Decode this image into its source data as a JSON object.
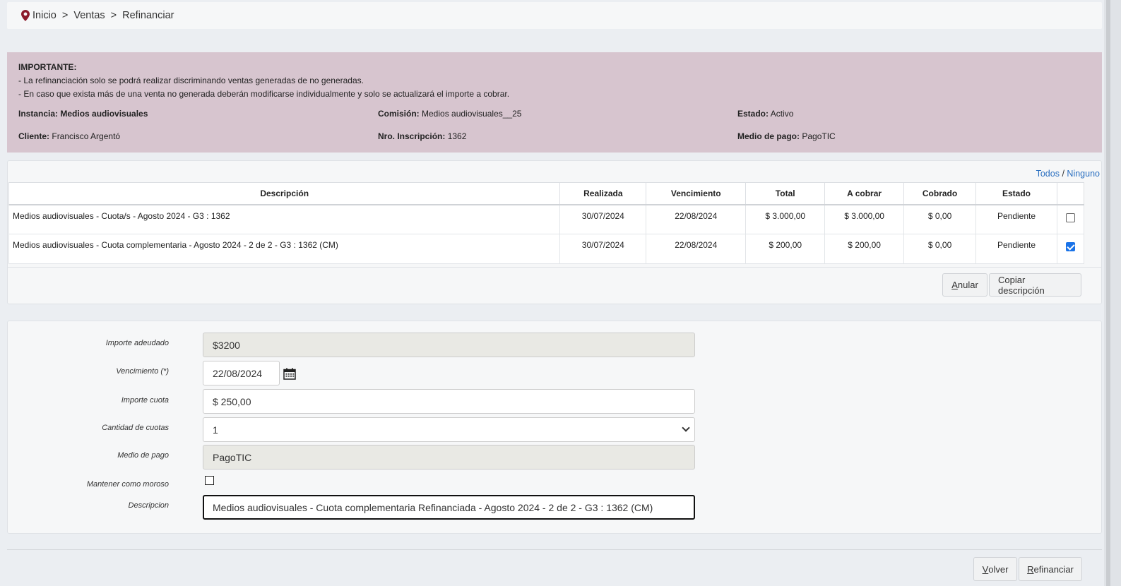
{
  "breadcrumb": {
    "items": [
      "Inicio",
      "Ventas",
      "Refinanciar"
    ],
    "separator": ">"
  },
  "alert": {
    "heading": "IMPORTANTE:",
    "lines": [
      "- La refinanciación solo se podrá realizar discriminando ventas generadas de no generadas.",
      "- En caso que exista más de una venta no generada deberán modificarse individualmente y solo se actualizará el importe a cobrar."
    ],
    "fields": {
      "instancia_label": "Instancia:",
      "instancia_value": "Medios audiovisuales",
      "comision_label": "Comisión:",
      "comision_value": "Medios audiovisuales__25",
      "estado_label": "Estado:",
      "estado_value": "Activo",
      "cliente_label": "Cliente:",
      "cliente_value": "Francisco Argentó",
      "inscripcion_label": "Nro. Inscripción:",
      "inscripcion_value": "1362",
      "medio_label": "Medio de pago:",
      "medio_value": "PagoTIC"
    }
  },
  "selection": {
    "all": "Todos",
    "slash": "/",
    "none": "Ninguno"
  },
  "table": {
    "columns": [
      "Descripción",
      "Realizada",
      "Vencimiento",
      "Total",
      "A cobrar",
      "Cobrado",
      "Estado"
    ],
    "rows": [
      {
        "descripcion": "Medios audiovisuales - Cuota/s - Agosto 2024 - G3 : 1362",
        "realizada": "30/07/2024",
        "vencimiento": "22/08/2024",
        "total": "$ 3.000,00",
        "a_cobrar": "$ 3.000,00",
        "cobrado": "$ 0,00",
        "estado": "Pendiente",
        "checked": false
      },
      {
        "descripcion": "Medios audiovisuales - Cuota complementaria - Agosto 2024 - 2 de 2 - G3 : 1362 (CM)",
        "realizada": "30/07/2024",
        "vencimiento": "22/08/2024",
        "total": "$ 200,00",
        "a_cobrar": "$ 200,00",
        "cobrado": "$ 0,00",
        "estado": "Pendiente",
        "checked": true
      }
    ]
  },
  "table_actions": {
    "anular_first": "A",
    "anular_rest": "nular",
    "copiar": "Copiar descripción"
  },
  "form": {
    "importe_adeudado_label": "Importe adeudado",
    "importe_adeudado_value": "$3200",
    "vencimiento_label": "Vencimiento (*)",
    "vencimiento_value": "22/08/2024",
    "importe_cuota_label": "Importe cuota",
    "importe_cuota_value": "$ 250,00",
    "cantidad_cuotas_label": "Cantidad de cuotas",
    "cantidad_cuotas_value": "1",
    "medio_pago_label": "Medio de pago",
    "medio_pago_value": "PagoTIC",
    "moroso_label": "Mantener como moroso",
    "moroso_checked": false,
    "descripcion_label": "Descripcion",
    "descripcion_value": "Medios audiovisuales - Cuota complementaria Refinanciada -  Agosto 2024 - 2 de 2 - G3 : 1362 (CM)"
  },
  "footer": {
    "volver_first": "V",
    "volver_rest": "olver",
    "refinanciar_first": "R",
    "refinanciar_rest": "efinanciar"
  },
  "colors": {
    "alert_bg": "#d7c5cf",
    "link": "#2a6fc0",
    "checkbox_on": "#1a73e8",
    "pin": "#8b1a2b"
  }
}
